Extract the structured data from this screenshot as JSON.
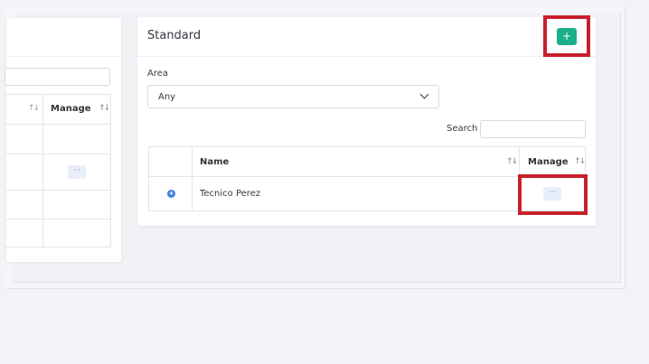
{
  "standard_card": {
    "title": "Standard",
    "add_label": "+",
    "area_label": "Area",
    "area_value": "Any",
    "search_label": "Search",
    "search_value": "",
    "columns": [
      "Name",
      "Manage"
    ],
    "rows": [
      {
        "name": "Tecnico Perez",
        "manage_label": "···"
      }
    ]
  },
  "left_card": {
    "columns": [
      "Manage"
    ],
    "rows": [
      {
        "manage_label": ""
      },
      {
        "manage_label": "···"
      },
      {
        "manage_label": ""
      },
      {
        "manage_label": ""
      }
    ]
  },
  "icons": {
    "info": "info-circle-icon",
    "sort": "sort-arrows-icon",
    "chevron": "chevron-down-icon",
    "more": "more-dots-icon"
  },
  "colors": {
    "add_button": "#1aae8a",
    "highlight": "#c8202a",
    "info_icon": "#3f7fe0"
  }
}
